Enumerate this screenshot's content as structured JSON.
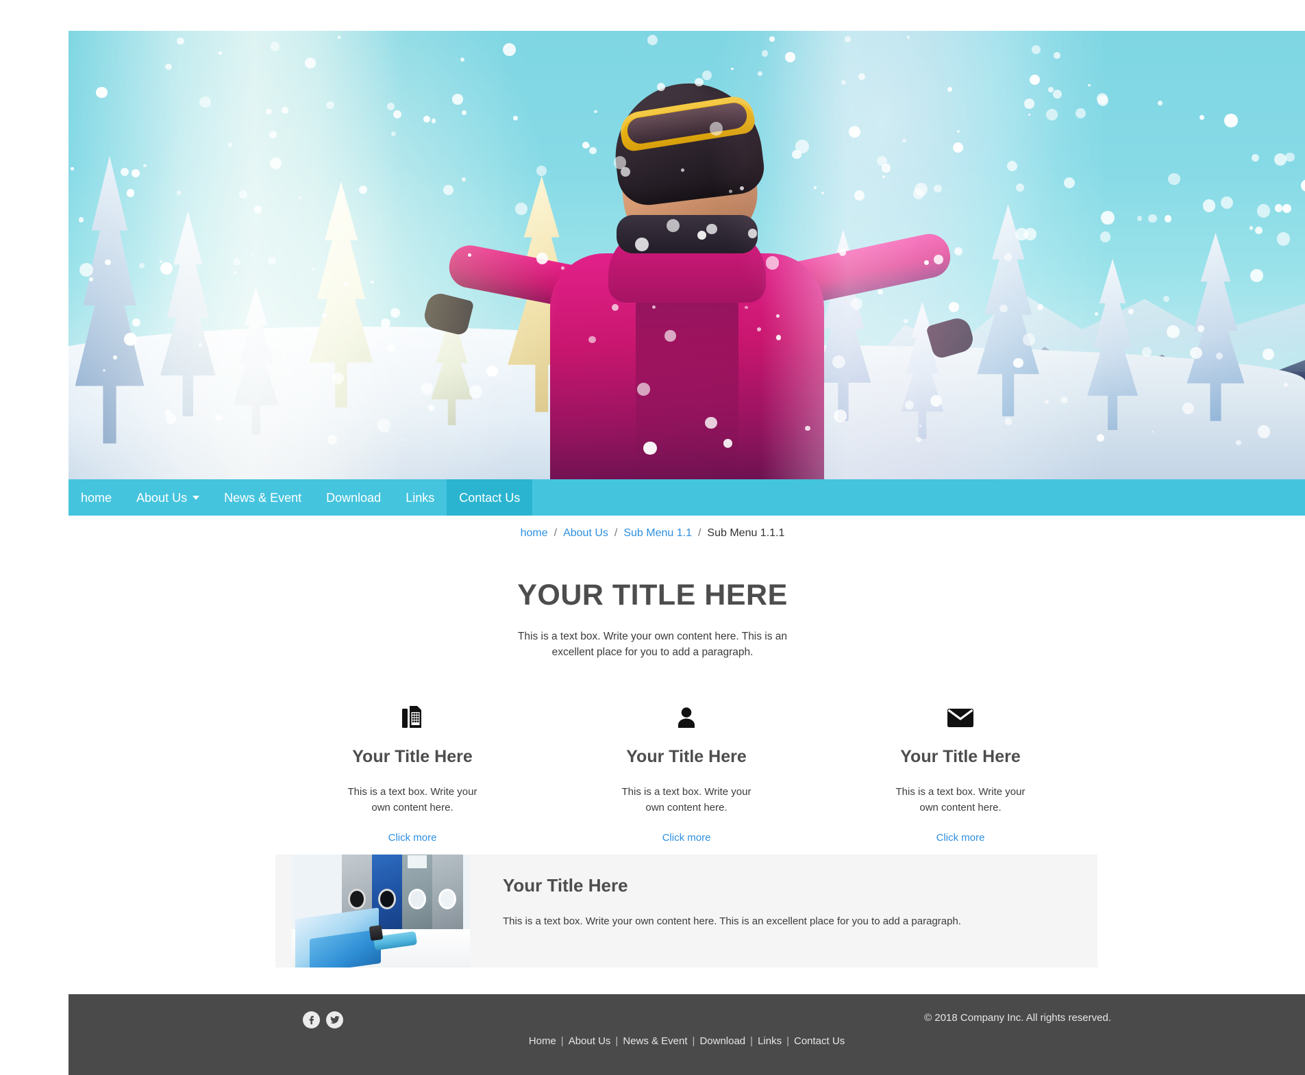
{
  "hero": {
    "alt": "Skier in pink jacket with helmet and goggles celebrating in snowy forest",
    "image_name": "winter-ski-hero-photo"
  },
  "nav": {
    "items": [
      {
        "label": "home",
        "active": false,
        "has_caret": false
      },
      {
        "label": "About Us",
        "active": false,
        "has_caret": true
      },
      {
        "label": "News & Event",
        "active": false,
        "has_caret": false
      },
      {
        "label": "Download",
        "active": false,
        "has_caret": false
      },
      {
        "label": "Links",
        "active": false,
        "has_caret": false
      },
      {
        "label": "Contact Us",
        "active": true,
        "has_caret": false
      }
    ],
    "background_color": "#45c4de",
    "active_color": "#2ab4d0"
  },
  "breadcrumb": {
    "items": [
      {
        "label": "home",
        "link": true
      },
      {
        "label": "About Us",
        "link": true
      },
      {
        "label": "Sub Menu 1.1",
        "link": true
      },
      {
        "label": "Sub Menu 1.1.1",
        "link": false
      }
    ],
    "separator": "/"
  },
  "main": {
    "title": "YOUR TITLE HERE",
    "subtitle": "This is a text box. Write your own content here. This is an excellent place for you to add a paragraph."
  },
  "columns": [
    {
      "icon": "fax-icon",
      "title": "Your Title Here",
      "text": "This is a text box. Write your own content here.",
      "link_label": "Click more"
    },
    {
      "icon": "user-icon",
      "title": "Your Title Here",
      "text": "This is a text box. Write your own content here.",
      "link_label": "Click more"
    },
    {
      "icon": "envelope-icon",
      "title": "Your Title Here",
      "text": "This is a text box. Write your own content here.",
      "link_label": "Click more"
    }
  ],
  "feature": {
    "image_name": "office-binders-photo",
    "title": "Your Title Here",
    "text": "This is a text box. Write your own content here. This is an excellent place for you to add a paragraph."
  },
  "footer": {
    "social": [
      {
        "name": "facebook-icon",
        "glyph": "f"
      },
      {
        "name": "twitter-icon",
        "glyph": "t"
      }
    ],
    "copyright": "© 2018 Company Inc. All rights reserved.",
    "nav": [
      "Home",
      "About Us",
      "News & Event",
      "Download",
      "Links",
      "Contact Us"
    ],
    "separator": "|",
    "background_color": "#4a4a4a"
  },
  "colors": {
    "accent": "#45c4de",
    "accent_active": "#2ab4d0",
    "link": "#2d8fe0",
    "heading": "#4d4d4d",
    "footer_bg": "#4a4a4a",
    "card_bg": "#f5f5f5"
  }
}
